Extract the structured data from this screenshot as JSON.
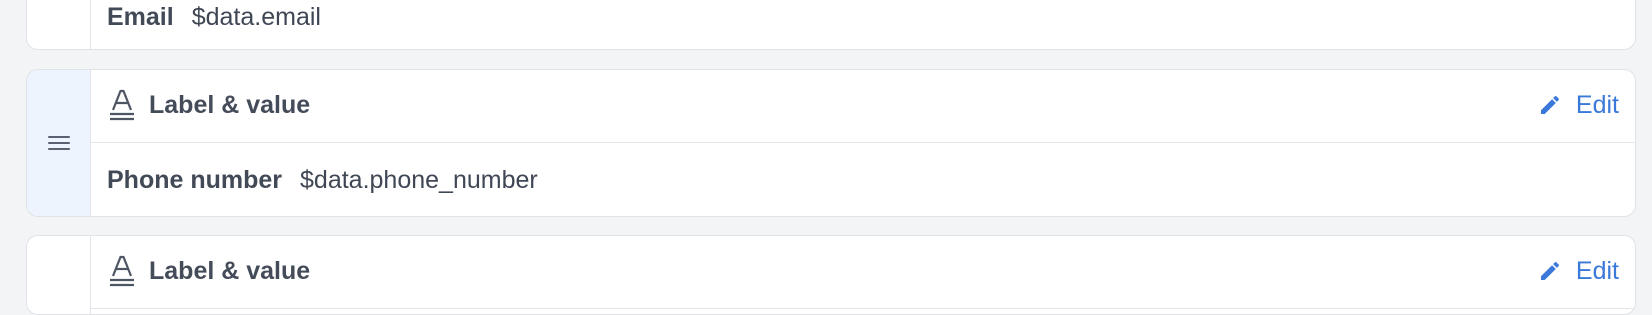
{
  "fields": [
    {
      "field_label": "Email",
      "value": "$data.email"
    },
    {
      "type_label": "Label & value",
      "edit_label": "Edit",
      "field_label": "Phone number",
      "value": "$data.phone_number"
    },
    {
      "type_label": "Label & value",
      "edit_label": "Edit"
    }
  ],
  "colors": {
    "accent": "#3a78d9",
    "selected_gutter": "#edf4fd",
    "page_background": "#f3f4f6"
  },
  "icons": {
    "type": "label-value-icon",
    "edit": "pencil-icon",
    "drag": "drag-handle-icon"
  }
}
